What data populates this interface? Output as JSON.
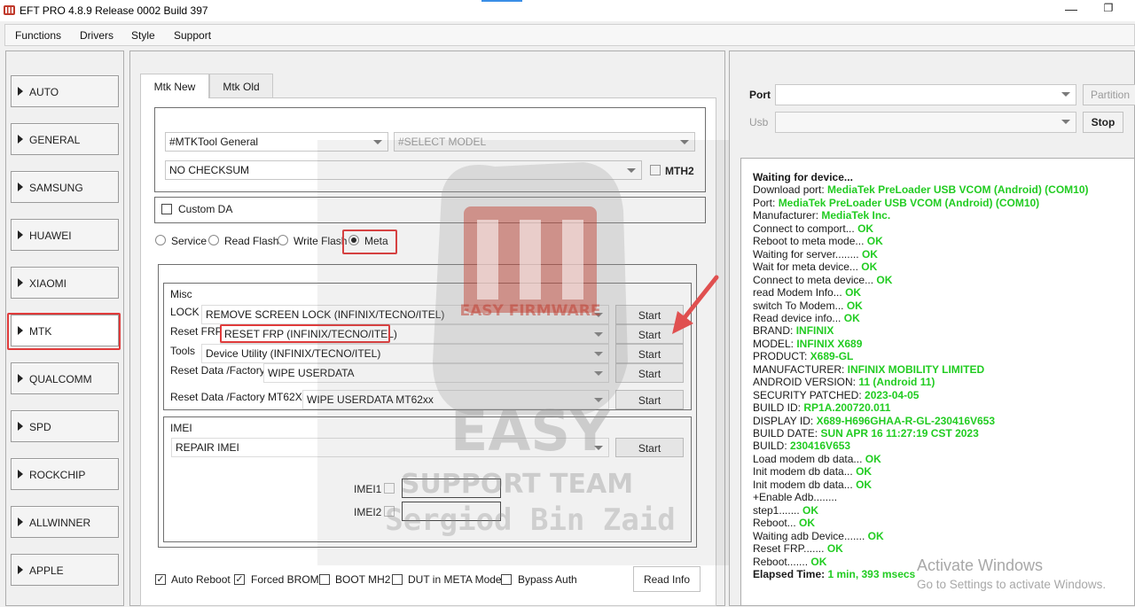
{
  "window": {
    "title": "EFT PRO 4.8.9 Release 0002 Build 397",
    "app_icon": "eft-logo-icon",
    "controls": [
      "minimize-icon",
      "restore-icon"
    ]
  },
  "menu": [
    "Functions",
    "Drivers",
    "Style",
    "Support"
  ],
  "brands": [
    "AUTO",
    "GENERAL",
    "SAMSUNG",
    "HUAWEI",
    "XIAOMI",
    "MTK",
    "QUALCOMM",
    "SPD",
    "ROCKCHIP",
    "ALLWINNER",
    "APPLE"
  ],
  "selected_brand": "MTK",
  "tabs": [
    "Mtk New",
    "Mtk Old"
  ],
  "active_tab": "Mtk New",
  "tool": {
    "type_value": "#MTKTool General",
    "model_placeholder": "#SELECT MODEL",
    "checksum_value": "NO CHECKSUM",
    "mth2_label": "MTH2",
    "custom_da_label": "Custom DA"
  },
  "modes": {
    "service": "Service",
    "read_flash": "Read Flash",
    "write_flash": "Write Flash",
    "meta": "Meta",
    "selected": "Meta"
  },
  "misc": {
    "title": "Misc",
    "lock_label": "LOCK",
    "lock_value": "REMOVE SCREEN LOCK (INFINIX/TECNO/ITEL)",
    "reset_frp_label": "Reset FRP",
    "reset_frp_value": "RESET FRP (INFINIX/TECNO/ITEL)",
    "tools_label": "Tools",
    "tools_value": "Device Utility (INFINIX/TECNO/ITEL)",
    "reset_data_label": "Reset Data /Factory",
    "reset_data_value": "WIPE USERDATA",
    "reset_data_mt62_label": "Reset Data /Factory MT62XX",
    "reset_data_mt62_value": "WIPE USERDATA MT62xx",
    "start_label": "Start"
  },
  "imei": {
    "title": "IMEI",
    "value": "REPAIR IMEI",
    "start_label": "Start",
    "imei1_label": "IMEI1",
    "imei2_label": "IMEI2"
  },
  "options": {
    "auto_reboot": "Auto Reboot",
    "forced_brom": "Forced BROM",
    "boot_mh2": "BOOT MH2",
    "dut_meta": "DUT in META Mode",
    "bypass_auth": "Bypass Auth",
    "read_info": "Read Info"
  },
  "option_states": {
    "auto_reboot": true,
    "forced_brom": true,
    "boot_mh2": false,
    "dut_meta": false,
    "bypass_auth": false
  },
  "watermark": {
    "line1": "EASY FIRMWARE",
    "line2": "EASY",
    "line3": "SUPPORT TEAM",
    "line4": "Sergiod Bin Zaid"
  },
  "connection": {
    "port_label": "Port",
    "usb_label": "Usb",
    "partition_label": "Partition",
    "stop_label": "Stop"
  },
  "log": [
    {
      "t": "Waiting for device...",
      "v": "",
      "bold": true
    },
    {
      "t": "Download port: ",
      "v": "MediaTek PreLoader USB VCOM (Android) (COM10)"
    },
    {
      "t": "Port: ",
      "v": "MediaTek PreLoader USB VCOM (Android) (COM10)"
    },
    {
      "t": "Manufacturer: ",
      "v": "MediaTek Inc."
    },
    {
      "t": "Connect to comport... ",
      "v": "OK"
    },
    {
      "t": "Reboot to meta mode... ",
      "v": "OK"
    },
    {
      "t": "Waiting for server........ ",
      "v": "OK"
    },
    {
      "t": "Wait for meta device... ",
      "v": "OK"
    },
    {
      "t": "Connect to meta device... ",
      "v": "OK"
    },
    {
      "t": "read Modem Info... ",
      "v": "OK"
    },
    {
      "t": "switch To Modem... ",
      "v": "OK"
    },
    {
      "t": "Read device info... ",
      "v": "OK"
    },
    {
      "t": " BRAND: ",
      "v": "INFINIX"
    },
    {
      "t": " MODEL: ",
      "v": "INFINIX X689"
    },
    {
      "t": " PRODUCT: ",
      "v": "X689-GL"
    },
    {
      "t": " MANUFACTURER: ",
      "v": "INFINIX MOBILITY LIMITED"
    },
    {
      "t": " ANDROID VERSION: ",
      "v": "11 (Android 11)"
    },
    {
      "t": " SECURITY PATCHED: ",
      "v": "2023-04-05"
    },
    {
      "t": " BUILD ID: ",
      "v": "RP1A.200720.011"
    },
    {
      "t": " DISPLAY ID: ",
      "v": "X689-H696GHAA-R-GL-230416V653"
    },
    {
      "t": " BUILD DATE: ",
      "v": "SUN APR 16 11:27:19 CST 2023"
    },
    {
      "t": " BUILD: ",
      "v": "230416V653"
    },
    {
      "t": "Load modem db data... ",
      "v": "OK"
    },
    {
      "t": "Init modem db data... ",
      "v": "OK"
    },
    {
      "t": "Init modem db data... ",
      "v": "OK"
    },
    {
      "t": "+Enable Adb........",
      "v": ""
    },
    {
      "t": "step1....... ",
      "v": "OK"
    },
    {
      "t": "Reboot... ",
      "v": "OK"
    },
    {
      "t": "Waiting adb Device....... ",
      "v": "OK"
    },
    {
      "t": "Reset FRP....... ",
      "v": "OK"
    },
    {
      "t": "Reboot....... ",
      "v": "OK"
    },
    {
      "t": "Elapsed Time: ",
      "v": "1 min, 393 msecs",
      "bold": true
    }
  ],
  "activation": {
    "title": "Activate Windows",
    "subtitle": "Go to Settings to activate Windows."
  },
  "colors": {
    "highlight": "#e03b3b",
    "ok_green": "#22cc22",
    "watermark_red": "#c0392b"
  }
}
